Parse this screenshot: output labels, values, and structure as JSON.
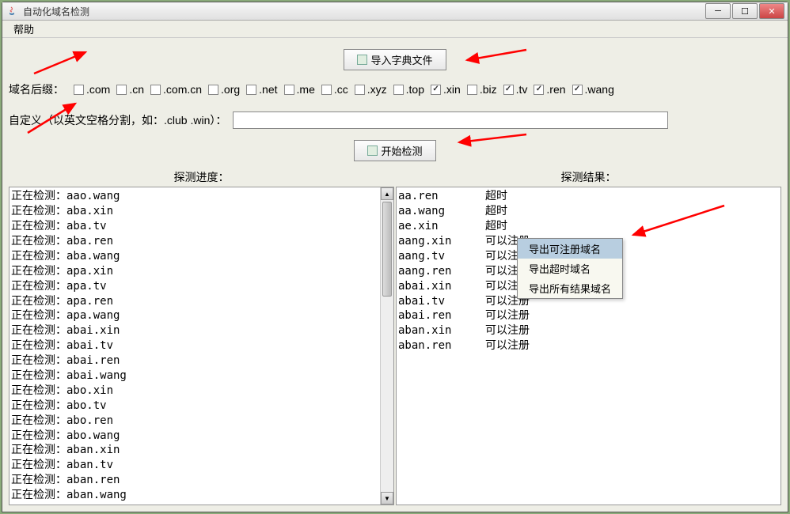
{
  "window": {
    "title": "自动化域名检测"
  },
  "menu": {
    "help": "帮助"
  },
  "buttons": {
    "import_dict": "导入字典文件",
    "start_detect": "开始检测"
  },
  "suffix": {
    "label": "域名后缀：",
    "options": [
      {
        "label": ".com",
        "checked": false
      },
      {
        "label": ".cn",
        "checked": false
      },
      {
        "label": ".com.cn",
        "checked": false
      },
      {
        "label": ".org",
        "checked": false
      },
      {
        "label": ".net",
        "checked": false
      },
      {
        "label": ".me",
        "checked": false
      },
      {
        "label": ".cc",
        "checked": false
      },
      {
        "label": ".xyz",
        "checked": false
      },
      {
        "label": ".top",
        "checked": false
      },
      {
        "label": ".xin",
        "checked": true
      },
      {
        "label": ".biz",
        "checked": false
      },
      {
        "label": ".tv",
        "checked": true
      },
      {
        "label": ".ren",
        "checked": true
      },
      {
        "label": ".wang",
        "checked": true
      }
    ]
  },
  "custom": {
    "label": "自定义（以英文空格分割，如：.club .win）：",
    "value": ""
  },
  "progress": {
    "header": "探测进度：",
    "prefix": "正在检测：",
    "items": [
      "aao.wang",
      "aba.xin",
      "aba.tv",
      "aba.ren",
      "aba.wang",
      "apa.xin",
      "apa.tv",
      "apa.ren",
      "apa.wang",
      "abai.xin",
      "abai.tv",
      "abai.ren",
      "abai.wang",
      "abo.xin",
      "abo.tv",
      "abo.ren",
      "abo.wang",
      "aban.xin",
      "aban.tv",
      "aban.ren",
      "aban.wang"
    ]
  },
  "results": {
    "header": "探测结果：",
    "items": [
      {
        "domain": "aa.ren",
        "status": "超时"
      },
      {
        "domain": "aa.wang",
        "status": "超时"
      },
      {
        "domain": "ae.xin",
        "status": "超时"
      },
      {
        "domain": "aang.xin",
        "status": "可以注册"
      },
      {
        "domain": "aang.tv",
        "status": "可以注册"
      },
      {
        "domain": "aang.ren",
        "status": "可以注册"
      },
      {
        "domain": "abai.xin",
        "status": "可以注册"
      },
      {
        "domain": "abai.tv",
        "status": "可以注册"
      },
      {
        "domain": "abai.ren",
        "status": "可以注册"
      },
      {
        "domain": "aban.xin",
        "status": "可以注册"
      },
      {
        "domain": "aban.ren",
        "status": "可以注册"
      }
    ]
  },
  "context_menu": {
    "items": [
      "导出可注册域名",
      "导出超时域名",
      "导出所有结果域名"
    ],
    "highlighted_index": 0
  }
}
